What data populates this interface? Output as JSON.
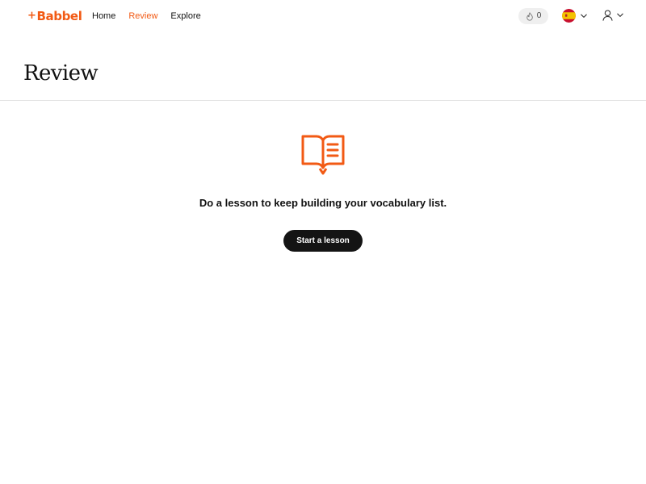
{
  "brand": {
    "plus": "+",
    "name": "Babbel",
    "accent_color": "#f25a14"
  },
  "nav": {
    "items": [
      {
        "label": "Home",
        "active": false
      },
      {
        "label": "Review",
        "active": true
      },
      {
        "label": "Explore",
        "active": false
      }
    ]
  },
  "header_actions": {
    "streak": {
      "icon": "flame-icon",
      "count": "0"
    },
    "language": {
      "flag": "spain-flag-icon",
      "chevron": "chevron-down-icon"
    },
    "account": {
      "icon": "user-icon",
      "chevron": "chevron-down-icon"
    }
  },
  "page": {
    "title": "Review"
  },
  "empty_state": {
    "icon": "open-book-icon",
    "message": "Do a lesson to keep building your vocabulary list.",
    "button_label": "Start a lesson",
    "button_color": "#141414"
  }
}
